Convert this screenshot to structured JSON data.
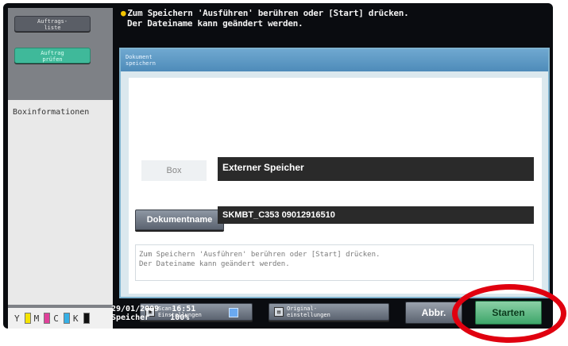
{
  "sidebar": {
    "job_list_label": "Auftrags-\nliste",
    "job_check_label": "Auftrag\nprüfen",
    "box_info_label": "Boxinformationen",
    "toner": [
      "Y",
      "M",
      "C",
      "K"
    ]
  },
  "header": {
    "message_line1": "Zum Speichern 'Ausführen' berühren oder [Start] drücken.",
    "message_line2": "Der Dateiname kann geändert werden."
  },
  "dialog": {
    "title": "Dokument\nspeichern",
    "box_label": "Box",
    "box_value": "Externer Speicher",
    "docname_button": "Dokumentname",
    "docname_value": "SKMBT_C353 09012916510",
    "info_line1": "Zum Speichern 'Ausführen' berühren oder [Start] drücken.",
    "info_line2": "Der Dateiname kann geändert werden.",
    "scan_settings_label": "Scan-\nEinstellungen",
    "original_settings_label": "Original-\neinstellungen"
  },
  "status": {
    "date": "29/01/2009",
    "time": "16:51",
    "memory_label": "Speicher",
    "memory_value": "100%"
  },
  "footer": {
    "cancel_label": "Abbr.",
    "start_label": "Starten"
  },
  "colors": {
    "accent_green": "#3ea66a",
    "annotation_red": "#e0000f",
    "dialog_header": "#4e8bb9"
  }
}
